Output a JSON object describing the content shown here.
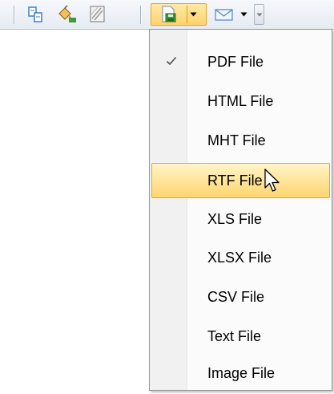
{
  "toolbar": {
    "buttons": [
      {
        "icon": "multiple-pages-icon"
      },
      {
        "icon": "background-color-icon"
      },
      {
        "icon": "watermark-icon"
      },
      {
        "icon": "export-document-icon",
        "active": true
      },
      {
        "icon": "send-email-icon"
      }
    ]
  },
  "export_menu": {
    "items": [
      {
        "label": "PDF File",
        "checked": true
      },
      {
        "label": "HTML File"
      },
      {
        "label": "MHT File"
      },
      {
        "label": "RTF File",
        "highlighted": true
      },
      {
        "label": "XLS File"
      },
      {
        "label": "XLSX File"
      },
      {
        "label": "CSV File"
      },
      {
        "label": "Text File"
      },
      {
        "label": "Image File"
      }
    ]
  },
  "colors": {
    "highlight_top": "#fff5c8",
    "highlight_bottom": "#ffd56f",
    "highlight_border": "#e2a53b",
    "menu_background": "#fbfbfb",
    "toolbar_background": "#e6ebf2"
  }
}
